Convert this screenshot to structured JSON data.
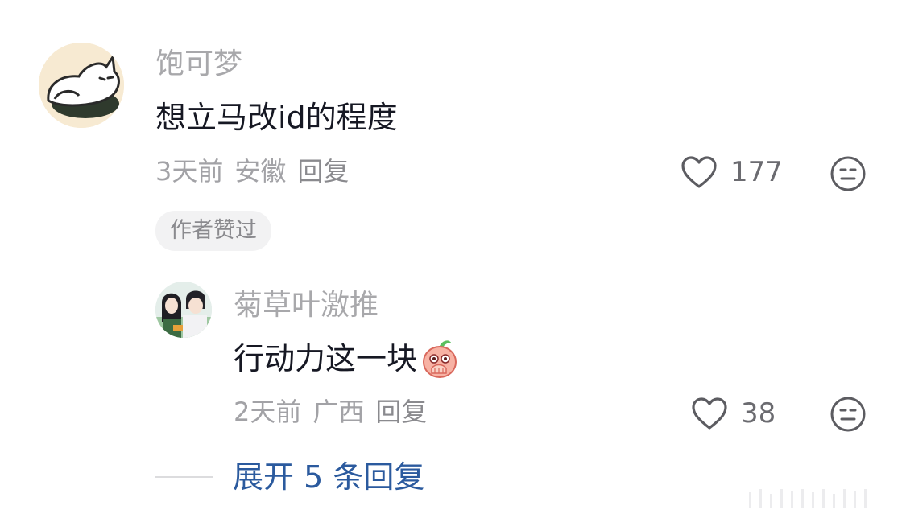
{
  "comment": {
    "username": "饱可梦",
    "text": "想立马改id的程度",
    "time": "3天前",
    "location": "安徽",
    "reply_label": "回复",
    "likes": "177",
    "badge": "作者赞过"
  },
  "reply": {
    "username": "菊草叶激推",
    "text": "行动力这一块",
    "emoji": "peach-hand-over-mouth-emoji",
    "time": "2天前",
    "location": "广西",
    "reply_label": "回复",
    "likes": "38"
  },
  "expand": {
    "label": "展开 5 条回复"
  },
  "colors": {
    "text_primary": "#161823",
    "text_secondary": "#a8a8ab",
    "link_blue": "#2b5a9e",
    "badge_bg": "#f2f2f3"
  }
}
